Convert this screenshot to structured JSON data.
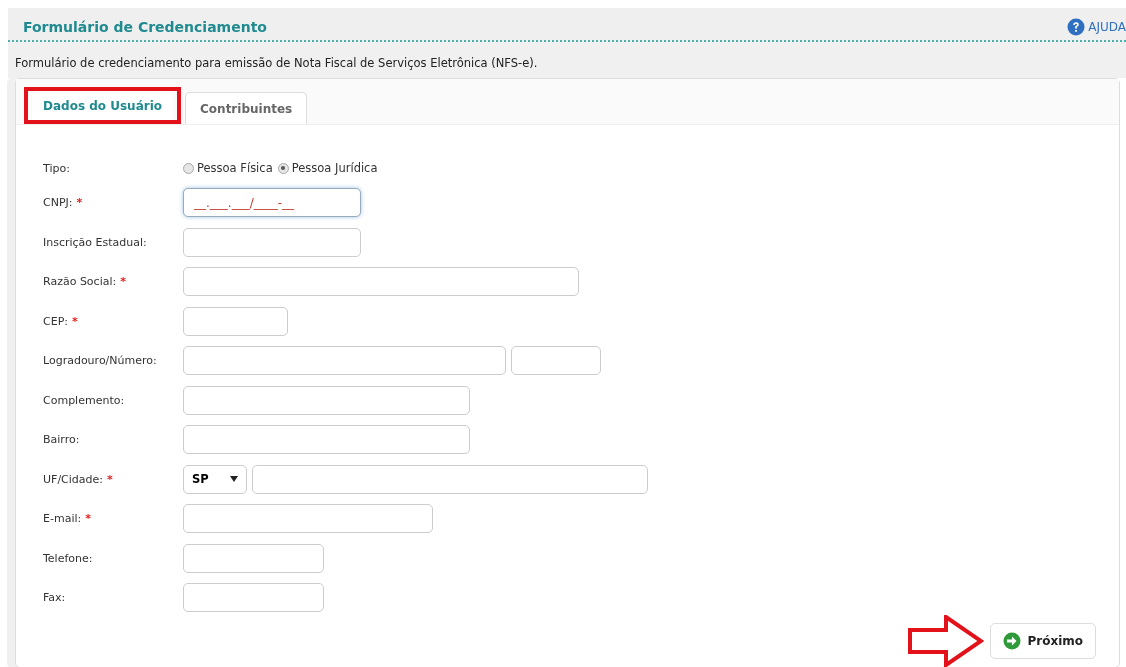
{
  "header": {
    "title": "Formulário de Credenciamento",
    "help": "AJUDA"
  },
  "description": "Formulário de credenciamento para emissão de Nota Fiscal de Serviços Eletrônica (NFS-e).",
  "tabs": [
    {
      "label": "Dados do Usuário",
      "selected": true,
      "highlighted": true
    },
    {
      "label": "Contribuintes",
      "selected": false,
      "highlighted": false
    }
  ],
  "fields": [
    {
      "kind": "radio",
      "label": "Tipo:",
      "options": [
        {
          "label": "Pessoa Física",
          "selected": false
        },
        {
          "label": "Pessoa Jurídica",
          "selected": true
        }
      ]
    },
    {
      "kind": "text",
      "label": "CNPJ:",
      "required_mark": "*",
      "value": "__.___.___/____-__",
      "focused": true
    },
    {
      "kind": "text",
      "label": "Inscrição Estadual:"
    },
    {
      "kind": "text",
      "label": "Razão Social:",
      "required_mark": "*"
    },
    {
      "kind": "text",
      "label": "CEP:",
      "required_mark": "*"
    },
    {
      "kind": "pair",
      "label": "Logradouro/Número:"
    },
    {
      "kind": "text",
      "label": "Complemento:"
    },
    {
      "kind": "text",
      "label": "Bairro:"
    },
    {
      "kind": "select",
      "label": "UF/Cidade:",
      "required_mark": "*",
      "value": "SP"
    },
    {
      "kind": "text",
      "label": "E-mail:",
      "required_mark": "*"
    },
    {
      "kind": "text",
      "label": "Telefone:"
    },
    {
      "kind": "text",
      "label": "Fax:"
    }
  ],
  "next_button": {
    "label": "Próximo",
    "pointed": true
  }
}
